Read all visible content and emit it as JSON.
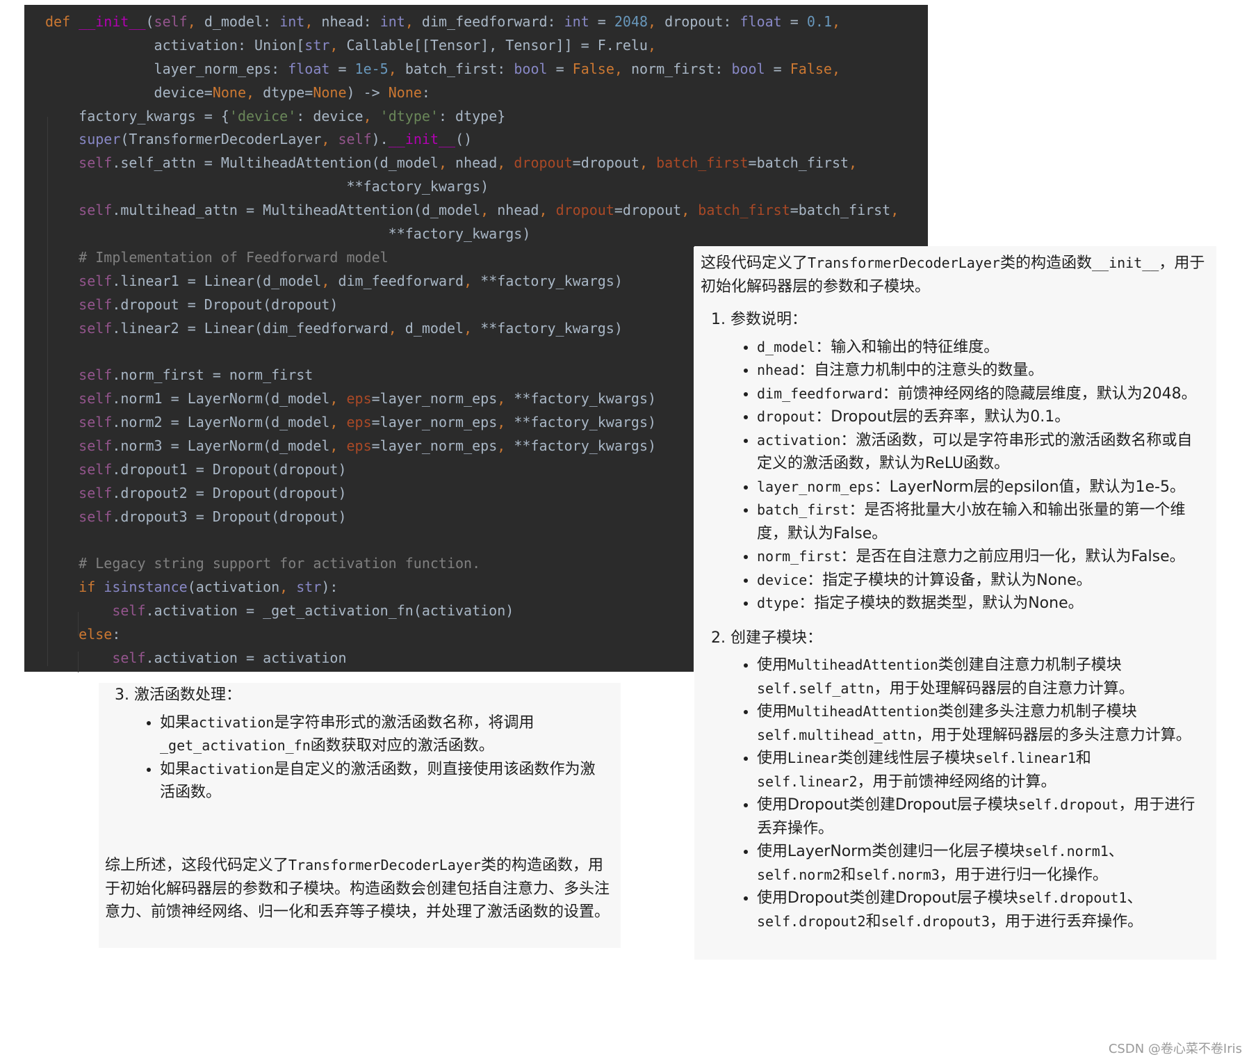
{
  "code": {
    "lines": [
      [
        [
          "kw",
          "def "
        ],
        [
          "mag",
          "__init__"
        ],
        [
          "t",
          "("
        ],
        [
          "self",
          "self"
        ],
        [
          "kw",
          ", "
        ],
        [
          "t",
          "d_model: "
        ],
        [
          "bi",
          "int"
        ],
        [
          "kw",
          ", "
        ],
        [
          "t",
          "nhead: "
        ],
        [
          "bi",
          "int"
        ],
        [
          "kw",
          ", "
        ],
        [
          "t",
          "dim_feedforward: "
        ],
        [
          "bi",
          "int"
        ],
        [
          "t",
          " = "
        ],
        [
          "num",
          "2048"
        ],
        [
          "kw",
          ", "
        ],
        [
          "t",
          "dropout: "
        ],
        [
          "bi",
          "float"
        ],
        [
          "t",
          " = "
        ],
        [
          "num",
          "0.1"
        ],
        [
          "kw",
          ","
        ]
      ],
      [
        [
          "t",
          "             activation: Union["
        ],
        [
          "bi",
          "str"
        ],
        [
          "kw",
          ", "
        ],
        [
          "t",
          "Callable[[Tensor], Tensor]] = F.relu"
        ],
        [
          "kw",
          ","
        ]
      ],
      [
        [
          "t",
          "             layer_norm_eps: "
        ],
        [
          "bi",
          "float"
        ],
        [
          "t",
          " = "
        ],
        [
          "num",
          "1e-5"
        ],
        [
          "kw",
          ", "
        ],
        [
          "t",
          "batch_first: "
        ],
        [
          "bi",
          "bool"
        ],
        [
          "t",
          " = "
        ],
        [
          "kw",
          "False"
        ],
        [
          "kw",
          ", "
        ],
        [
          "t",
          "norm_first: "
        ],
        [
          "bi",
          "bool"
        ],
        [
          "t",
          " = "
        ],
        [
          "kw",
          "False"
        ],
        [
          "kw",
          ","
        ]
      ],
      [
        [
          "t",
          "             device="
        ],
        [
          "kw",
          "None"
        ],
        [
          "kw",
          ", "
        ],
        [
          "t",
          "dtype="
        ],
        [
          "kw",
          "None"
        ],
        [
          "t",
          ") -> "
        ],
        [
          "kw",
          "None"
        ],
        [
          "t",
          ":"
        ]
      ],
      [
        [
          "t",
          "    factory_kwargs = {"
        ],
        [
          "str",
          "'device'"
        ],
        [
          "t",
          ": device"
        ],
        [
          "kw",
          ", "
        ],
        [
          "str",
          "'dtype'"
        ],
        [
          "t",
          ": dtype}"
        ]
      ],
      [
        [
          "t",
          "    "
        ],
        [
          "bi",
          "super"
        ],
        [
          "t",
          "(TransformerDecoderLayer"
        ],
        [
          "kw",
          ", "
        ],
        [
          "self",
          "self"
        ],
        [
          "t",
          ")."
        ],
        [
          "mag",
          "__init__"
        ],
        [
          "t",
          "()"
        ]
      ],
      [
        [
          "t",
          "    "
        ],
        [
          "self",
          "self"
        ],
        [
          "t",
          ".self_attn = MultiheadAttention(d_model"
        ],
        [
          "kw",
          ", "
        ],
        [
          "t",
          "nhead"
        ],
        [
          "kw",
          ", "
        ],
        [
          "named",
          "dropout"
        ],
        [
          "t",
          "=dropout"
        ],
        [
          "kw",
          ", "
        ],
        [
          "named",
          "batch_first"
        ],
        [
          "t",
          "=batch_first"
        ],
        [
          "kw",
          ","
        ]
      ],
      [
        [
          "t",
          "                                    **factory_kwargs)"
        ]
      ],
      [
        [
          "t",
          "    "
        ],
        [
          "self",
          "self"
        ],
        [
          "t",
          ".multihead_attn = MultiheadAttention(d_model"
        ],
        [
          "kw",
          ", "
        ],
        [
          "t",
          "nhead"
        ],
        [
          "kw",
          ", "
        ],
        [
          "named",
          "dropout"
        ],
        [
          "t",
          "=dropout"
        ],
        [
          "kw",
          ", "
        ],
        [
          "named",
          "batch_first"
        ],
        [
          "t",
          "=batch_first"
        ],
        [
          "kw",
          ","
        ]
      ],
      [
        [
          "t",
          "                                         **factory_kwargs)"
        ]
      ],
      [
        [
          "com",
          "    # Implementation of Feedforward model"
        ]
      ],
      [
        [
          "t",
          "    "
        ],
        [
          "self",
          "self"
        ],
        [
          "t",
          ".linear1 = Linear(d_model"
        ],
        [
          "kw",
          ", "
        ],
        [
          "t",
          "dim_feedforward"
        ],
        [
          "kw",
          ", "
        ],
        [
          "t",
          "**factory_kwargs)"
        ]
      ],
      [
        [
          "t",
          "    "
        ],
        [
          "self",
          "self"
        ],
        [
          "t",
          ".dropout = Dropout(dropout)"
        ]
      ],
      [
        [
          "t",
          "    "
        ],
        [
          "self",
          "self"
        ],
        [
          "t",
          ".linear2 = Linear(dim_feedforward"
        ],
        [
          "kw",
          ", "
        ],
        [
          "t",
          "d_model"
        ],
        [
          "kw",
          ", "
        ],
        [
          "t",
          "**factory_kwargs)"
        ]
      ],
      [],
      [
        [
          "t",
          "    "
        ],
        [
          "self",
          "self"
        ],
        [
          "t",
          ".norm_first = norm_first"
        ]
      ],
      [
        [
          "t",
          "    "
        ],
        [
          "self",
          "self"
        ],
        [
          "t",
          ".norm1 = LayerNorm(d_model"
        ],
        [
          "kw",
          ", "
        ],
        [
          "named",
          "eps"
        ],
        [
          "t",
          "=layer_norm_eps"
        ],
        [
          "kw",
          ", "
        ],
        [
          "t",
          "**factory_kwargs)"
        ]
      ],
      [
        [
          "t",
          "    "
        ],
        [
          "self",
          "self"
        ],
        [
          "t",
          ".norm2 = LayerNorm(d_model"
        ],
        [
          "kw",
          ", "
        ],
        [
          "named",
          "eps"
        ],
        [
          "t",
          "=layer_norm_eps"
        ],
        [
          "kw",
          ", "
        ],
        [
          "t",
          "**factory_kwargs)"
        ]
      ],
      [
        [
          "t",
          "    "
        ],
        [
          "self",
          "self"
        ],
        [
          "t",
          ".norm3 = LayerNorm(d_model"
        ],
        [
          "kw",
          ", "
        ],
        [
          "named",
          "eps"
        ],
        [
          "t",
          "=layer_norm_eps"
        ],
        [
          "kw",
          ", "
        ],
        [
          "t",
          "**factory_kwargs)"
        ]
      ],
      [
        [
          "t",
          "    "
        ],
        [
          "self",
          "self"
        ],
        [
          "t",
          ".dropout1 = Dropout(dropout)"
        ]
      ],
      [
        [
          "t",
          "    "
        ],
        [
          "self",
          "self"
        ],
        [
          "t",
          ".dropout2 = Dropout(dropout)"
        ]
      ],
      [
        [
          "t",
          "    "
        ],
        [
          "self",
          "self"
        ],
        [
          "t",
          ".dropout3 = Dropout(dropout)"
        ]
      ],
      [],
      [
        [
          "com",
          "    # Legacy string support for activation function."
        ]
      ],
      [
        [
          "kw",
          "    if "
        ],
        [
          "bi",
          "isinstance"
        ],
        [
          "t",
          "(activation"
        ],
        [
          "kw",
          ", "
        ],
        [
          "bi",
          "str"
        ],
        [
          "t",
          "):"
        ]
      ],
      [
        [
          "t",
          "        "
        ],
        [
          "self",
          "self"
        ],
        [
          "t",
          ".activation = _get_activation_fn(activation)"
        ]
      ],
      [
        [
          "kw",
          "    else"
        ],
        [
          "t",
          ":"
        ]
      ],
      [
        [
          "t",
          "        "
        ],
        [
          "self",
          "self"
        ],
        [
          "t",
          ".activation = activation"
        ]
      ]
    ]
  },
  "right_panel": {
    "intro": [
      [
        "t",
        "这段代码定义了"
      ],
      [
        "m",
        "TransformerDecoderLayer"
      ],
      [
        "t",
        "类的构造函数"
      ],
      [
        "m",
        "__init__"
      ],
      [
        "t",
        "，用于初始化解码器层的参数和子模块。"
      ]
    ],
    "section1": {
      "title": "1. 参数说明：",
      "items": [
        [
          [
            "m",
            "d_model"
          ],
          [
            "t",
            "：输入和输出的特征维度。"
          ]
        ],
        [
          [
            "m",
            "nhead"
          ],
          [
            "t",
            "：自注意力机制中的注意头的数量。"
          ]
        ],
        [
          [
            "m",
            "dim_feedforward"
          ],
          [
            "t",
            "：前馈神经网络的隐藏层维度，默认为2048。"
          ]
        ],
        [
          [
            "m",
            "dropout"
          ],
          [
            "t",
            "：Dropout层的丢弃率，默认为0.1。"
          ]
        ],
        [
          [
            "m",
            "activation"
          ],
          [
            "t",
            "：激活函数，可以是字符串形式的激活函数名称或自定义的激活函数，默认为ReLU函数。"
          ]
        ],
        [
          [
            "m",
            "layer_norm_eps"
          ],
          [
            "t",
            "：LayerNorm层的epsilon值，默认为1e-5。"
          ]
        ],
        [
          [
            "m",
            "batch_first"
          ],
          [
            "t",
            "：是否将批量大小放在输入和输出张量的第一个维度，默认为False。"
          ]
        ],
        [
          [
            "m",
            "norm_first"
          ],
          [
            "t",
            "：是否在自注意力之前应用归一化，默认为False。"
          ]
        ],
        [
          [
            "m",
            "device"
          ],
          [
            "t",
            "：指定子模块的计算设备，默认为None。"
          ]
        ],
        [
          [
            "m",
            "dtype"
          ],
          [
            "t",
            "：指定子模块的数据类型，默认为None。"
          ]
        ]
      ]
    },
    "section2": {
      "title": "2. 创建子模块：",
      "items": [
        [
          [
            "t",
            "使用"
          ],
          [
            "m",
            "MultiheadAttention"
          ],
          [
            "t",
            "类创建自注意力机制子模块"
          ],
          [
            "m",
            "self.self_attn"
          ],
          [
            "t",
            "，用于处理解码器层的自注意力计算。"
          ]
        ],
        [
          [
            "t",
            "使用"
          ],
          [
            "m",
            "MultiheadAttention"
          ],
          [
            "t",
            "类创建多头注意力机制子模块"
          ],
          [
            "m",
            "self.multihead_attn"
          ],
          [
            "t",
            "，用于处理解码器层的多头注意力计算。"
          ]
        ],
        [
          [
            "t",
            "使用"
          ],
          [
            "m",
            "Linear"
          ],
          [
            "t",
            "类创建线性层子模块"
          ],
          [
            "m",
            "self.linear1"
          ],
          [
            "t",
            "和"
          ],
          [
            "m",
            "self.linear2"
          ],
          [
            "t",
            "，用于前馈神经网络的计算。"
          ]
        ],
        [
          [
            "t",
            "使用Dropout类创建Dropout层子模块"
          ],
          [
            "m",
            "self.dropout"
          ],
          [
            "t",
            "，用于进行丢弃操作。"
          ]
        ],
        [
          [
            "t",
            "使用LayerNorm类创建归一化层子模块"
          ],
          [
            "m",
            "self.norm1"
          ],
          [
            "t",
            "、"
          ],
          [
            "m",
            "self.norm2"
          ],
          [
            "t",
            "和"
          ],
          [
            "m",
            "self.norm3"
          ],
          [
            "t",
            "，用于进行归一化操作。"
          ]
        ],
        [
          [
            "t",
            "使用Dropout类创建Dropout层子模块"
          ],
          [
            "m",
            "self.dropout1"
          ],
          [
            "t",
            "、"
          ],
          [
            "m",
            "self.dropout2"
          ],
          [
            "t",
            "和"
          ],
          [
            "m",
            "self.dropout3"
          ],
          [
            "t",
            "，用于进行丢弃操作。"
          ]
        ]
      ]
    }
  },
  "left_panel": {
    "section3": {
      "title": "3. 激活函数处理：",
      "items": [
        [
          [
            "t",
            "如果"
          ],
          [
            "m",
            "activation"
          ],
          [
            "t",
            "是字符串形式的激活函数名称，将调用"
          ],
          [
            "m",
            "_get_activation_fn"
          ],
          [
            "t",
            "函数获取对应的激活函数。"
          ]
        ],
        [
          [
            "t",
            "如果"
          ],
          [
            "m",
            "activation"
          ],
          [
            "t",
            "是自定义的激活函数，则直接使用该函数作为激活函数。"
          ]
        ]
      ]
    },
    "summary": [
      [
        "t",
        "综上所述，这段代码定义了"
      ],
      [
        "m",
        "TransformerDecoderLayer"
      ],
      [
        "t",
        "类的构造函数，用于初始化解码器层的参数和子模块。构造函数会创建包括自注意力、多头注意力、前馈神经网络、归一化和丢弃等子模块，并处理了激活函数的设置。"
      ]
    ]
  },
  "watermark": "CSDN @卷心菜不卷Iris",
  "colors": {
    "code_bg": "#2b2b2b",
    "keyword": "#cc7832",
    "self": "#94558d",
    "builtin": "#8888c6",
    "number": "#6897bb",
    "string": "#6a8759",
    "comment": "#808080",
    "panel_bg": "#f7f7f7"
  }
}
